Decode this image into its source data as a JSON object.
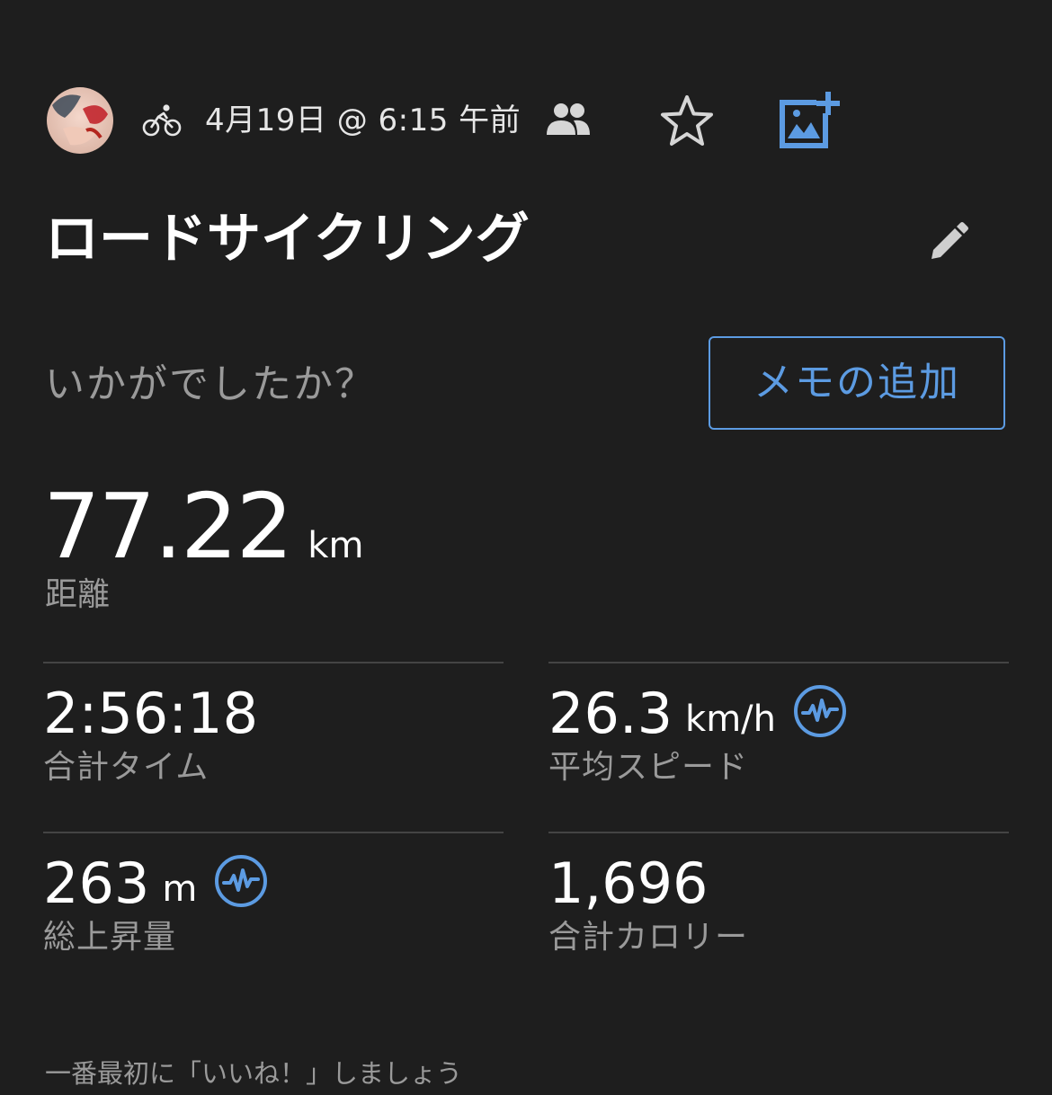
{
  "header": {
    "avatar_icon": "user-avatar",
    "activity_icon": "road-cycling-icon",
    "date_time": "4月19日 @ 6:15 午前",
    "people_icon": "people-icon",
    "star_icon": "star-outline-icon",
    "add_photo_icon": "add-photo-icon"
  },
  "activity": {
    "title": "ロードサイクリング",
    "edit_icon": "pencil-icon"
  },
  "notes": {
    "prompt": "いかがでしたか？",
    "add_memo_label": "メモの追加"
  },
  "distance": {
    "value": "77.22",
    "unit": "km",
    "label": "距離"
  },
  "stats": {
    "total_time": {
      "value": "2:56:18",
      "unit": "",
      "label": "合計タイム"
    },
    "avg_speed": {
      "value": "26.3",
      "unit": "km/h",
      "label": "平均スピード",
      "badge_icon": "performance-graph-icon"
    },
    "total_ascent": {
      "value": "263",
      "unit": "m",
      "label": "総上昇量",
      "badge_icon": "performance-graph-icon"
    },
    "total_calories": {
      "value": "1,696",
      "unit": "",
      "label": "合計カロリー"
    }
  },
  "footer": {
    "like_prompt": "一番最初に「いいね！」しましょう"
  },
  "colors": {
    "background": "#1e1e1e",
    "accent": "#5c9be2",
    "text_primary": "#ffffff",
    "text_secondary": "#9a9a9a",
    "divider": "#444444"
  }
}
